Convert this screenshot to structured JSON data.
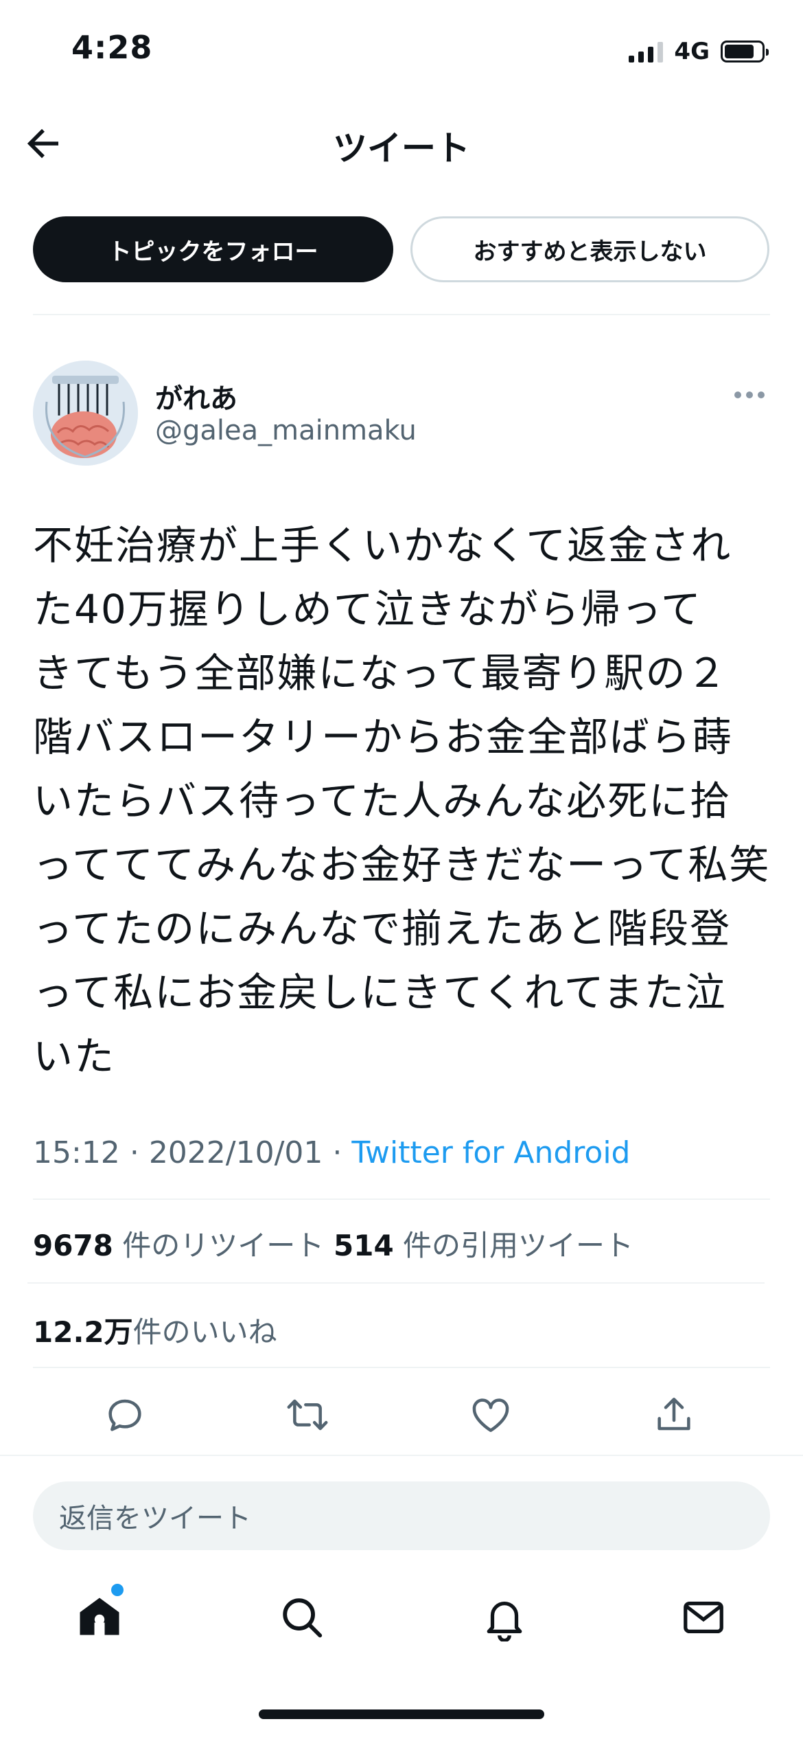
{
  "status_bar": {
    "time": "4:28",
    "network": "4G",
    "battery_level": 0.8
  },
  "header": {
    "title": "ツイート",
    "back_icon": "arrow-left-icon"
  },
  "topic_actions": {
    "follow_topic": "トピックをフォロー",
    "not_interested": "おすすめと表示しない"
  },
  "author": {
    "name": "がれあ",
    "handle": "@galea_mainmaku"
  },
  "tweet": {
    "text": "不妊治療が上手くいかなくて返金され\nた40万握りしめて泣きながら帰って\nきてもう全部嫌になって最寄り駅の２\n階バスロータリーからお金全部ばら蒔\nいたらバス待ってた人みんな必死に拾\nってててみんなお金好きだなーって私笑\nってたのにみんなで揃えたあと階段登\nって私にお金戻しにきてくれてまた泣\nいた",
    "time": "15:12",
    "date": "2022/10/01",
    "separator": "·",
    "source": "Twitter for Android"
  },
  "stats": {
    "retweets_count": "9678",
    "retweets_label": "件のリツイート",
    "quotes_count": "514",
    "quotes_label": "件の引用ツイート",
    "likes_count": "12.2万",
    "likes_label": "件のいいね"
  },
  "actions": [
    "reply-icon",
    "retweet-icon",
    "like-icon",
    "share-icon"
  ],
  "reply": {
    "placeholder": "返信をツイート"
  },
  "tab_bar": [
    "home-icon",
    "search-icon",
    "notifications-icon",
    "messages-icon"
  ],
  "colors": {
    "accent": "#1d9bf0",
    "text": "#0f1419",
    "secondary": "#536471",
    "divider": "#eff3f4"
  }
}
